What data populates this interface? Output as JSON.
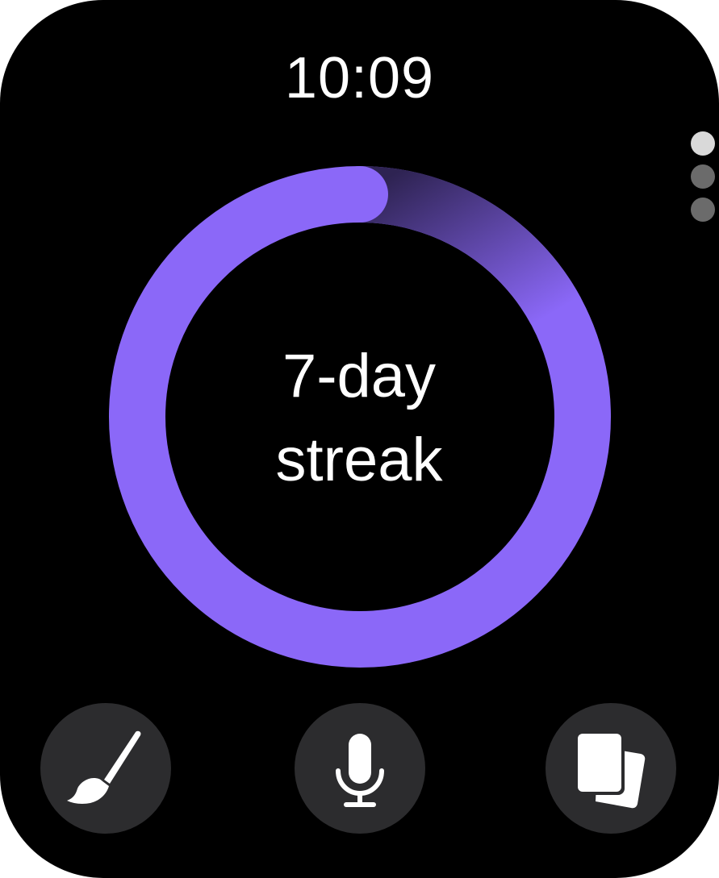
{
  "status_bar": {
    "time": "10:09"
  },
  "page_indicator": {
    "total_pages": 3,
    "current_page": 1
  },
  "streak": {
    "line1": "7-day",
    "line2": "streak",
    "ring_color": "#8b68f8",
    "progress_fraction": 1.0
  },
  "actions": [
    {
      "icon": "paintbrush-icon"
    },
    {
      "icon": "microphone-icon"
    },
    {
      "icon": "cards-icon"
    }
  ],
  "colors": {
    "background": "#000000",
    "button_bg": "#2c2c2e",
    "accent": "#8b68f8",
    "text": "#ffffff"
  }
}
